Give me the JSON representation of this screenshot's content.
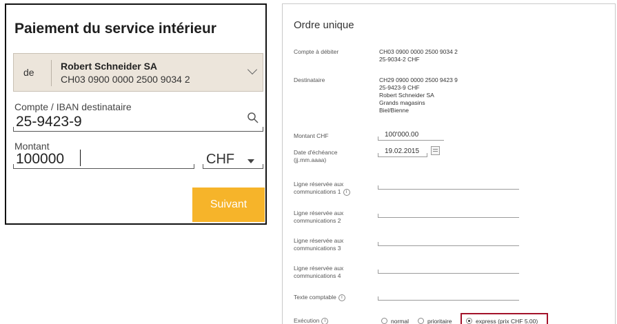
{
  "left": {
    "title": "Paiement du service intérieur",
    "account": {
      "prefix": "de",
      "name": "Robert Schneider SA",
      "iban": "CH03 0900 0000 2500 9034 2"
    },
    "recipient_field": {
      "label": "Compte / IBAN destinataire",
      "value": "25-9423-9"
    },
    "amount_field": {
      "label": "Montant",
      "value": "100000",
      "currency": "CHF"
    },
    "next_button": "Suivant",
    "accent_color": "#f6b42a"
  },
  "right": {
    "title": "Ordre unique",
    "debit": {
      "label": "Compte à débiter",
      "lines": [
        "CH03 0900 0000 2500 9034 2",
        "25-9034-2 CHF"
      ]
    },
    "recipient": {
      "label": "Destinataire",
      "lines": [
        "CH29 0900 0000 2500 9423 9",
        "25-9423-9 CHF",
        "Robert Schneider SA",
        "Grands magasins",
        "Biel/Bienne"
      ]
    },
    "amount": {
      "label": "Montant CHF",
      "value": "100'000.00"
    },
    "due_date": {
      "label": "Date d'échéance",
      "hint": "(jj.mm.aaaa)",
      "value": "19.02.2015"
    },
    "message_lines": [
      {
        "label_line1": "Ligne réservée aux",
        "label_line2": "communications 1",
        "info": "i"
      },
      {
        "label_line1": "Ligne réservée aux",
        "label_line2": "communications 2"
      },
      {
        "label_line1": "Ligne réservée aux",
        "label_line2": "communications 3"
      },
      {
        "label_line1": "Ligne réservée aux",
        "label_line2": "communications 4"
      }
    ],
    "accounting_text": {
      "label": "Texte comptable",
      "info": "i"
    },
    "execution": {
      "label": "Exécution",
      "info": "i",
      "options": [
        "normal",
        "prioritaire",
        "express (prix CHF 5.00)"
      ],
      "selected": "express (prix CHF 5.00)",
      "highlight_color": "#a3122a"
    }
  }
}
